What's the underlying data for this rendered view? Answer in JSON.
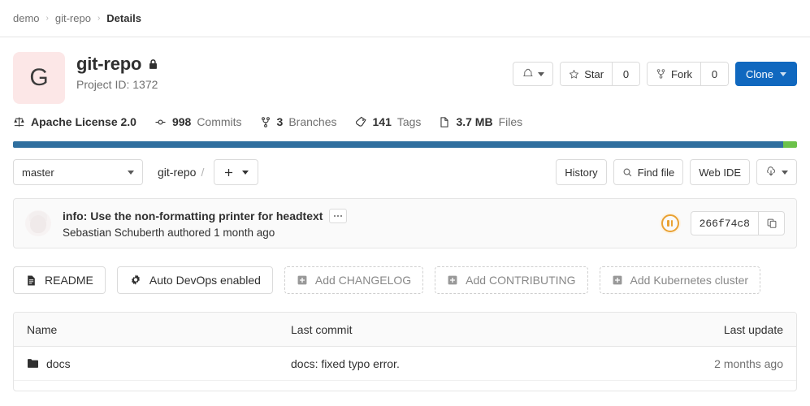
{
  "breadcrumb": {
    "items": [
      {
        "label": "demo",
        "current": false
      },
      {
        "label": "git-repo",
        "current": false
      },
      {
        "label": "Details",
        "current": true
      }
    ],
    "separator": "›"
  },
  "project": {
    "avatar_letter": "G",
    "avatar_bg": "#fce7e7",
    "name": "git-repo",
    "visibility_icon": "lock-icon",
    "project_id_label": "Project ID: 1372"
  },
  "header_actions": {
    "notification_icon": "bell-icon",
    "star_label": "Star",
    "star_count": "0",
    "fork_label": "Fork",
    "fork_count": "0",
    "clone_label": "Clone",
    "clone_color": "#1068bf"
  },
  "stats": [
    {
      "icon": "scale-icon",
      "value": "Apache License 2.0",
      "unit": ""
    },
    {
      "icon": "commit-icon",
      "value": "998",
      "unit": "Commits"
    },
    {
      "icon": "branch-icon",
      "value": "3",
      "unit": "Branches"
    },
    {
      "icon": "tag-icon",
      "value": "141",
      "unit": "Tags"
    },
    {
      "icon": "file-icon",
      "value": "3.7 MB",
      "unit": "Files"
    }
  ],
  "language_bar": {
    "segments": [
      {
        "name": "primary",
        "percent": 98.2,
        "color": "#2f6f9f"
      },
      {
        "name": "secondary",
        "percent": 1.8,
        "color": "#6cc24a"
      }
    ]
  },
  "repo_toolbar": {
    "branch": "master",
    "path_root": "git-repo",
    "path_separator": "/",
    "add_button_icon": "plus-icon",
    "history_label": "History",
    "find_file_label": "Find file",
    "web_ide_label": "Web IDE",
    "download_icon": "download-icon"
  },
  "commit": {
    "title": "info: Use the non-formatting printer for headtext",
    "author": "Sebastian Schuberth",
    "authored_text": "authored",
    "time_ago": "1 month ago",
    "sha": "266f74c8",
    "pipeline_status": "pending",
    "pipeline_status_color": "#e9a132",
    "copy_icon": "copy-icon",
    "more_icon": "ellipsis-icon"
  },
  "quick_actions": [
    {
      "label": "README",
      "icon": "doc-icon",
      "style": "solid"
    },
    {
      "label": "Auto DevOps enabled",
      "icon": "gear-icon",
      "style": "solid"
    },
    {
      "label": "Add CHANGELOG",
      "icon": "plus-square-icon",
      "style": "dashed"
    },
    {
      "label": "Add CONTRIBUTING",
      "icon": "plus-square-icon",
      "style": "dashed"
    },
    {
      "label": "Add Kubernetes cluster",
      "icon": "plus-square-icon",
      "style": "dashed"
    }
  ],
  "files_table": {
    "columns": {
      "name": "Name",
      "last_commit": "Last commit",
      "last_update": "Last update"
    },
    "rows": [
      {
        "icon": "folder-icon",
        "name": "docs",
        "last_commit": "docs: fixed typo error.",
        "last_update": "2 months ago"
      }
    ]
  }
}
